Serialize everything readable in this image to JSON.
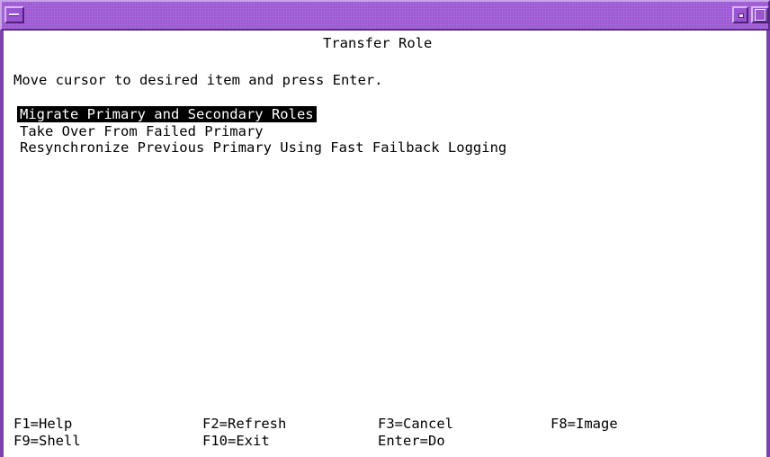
{
  "window": {
    "title": "Transfer Role"
  },
  "screen": {
    "instruction": "Move cursor to desired item and press Enter.",
    "options": [
      {
        "label": "Migrate Primary and Secondary Roles",
        "selected": true
      },
      {
        "label": "Take Over From Failed Primary",
        "selected": false
      },
      {
        "label": "Resynchronize Previous Primary Using Fast Failback Logging",
        "selected": false
      }
    ]
  },
  "function_keys": {
    "row1": [
      "F1=Help",
      "F2=Refresh",
      "F3=Cancel",
      "F8=Image"
    ],
    "row2": [
      "F9=Shell",
      "F10=Exit",
      "Enter=Do"
    ]
  },
  "colors": {
    "titlebar": "#9a55d3",
    "background": "#ffffff",
    "text": "#000000",
    "highlight_bg": "#000000",
    "highlight_fg": "#ffffff"
  },
  "icons": {
    "window_menu": "window-menu-icon",
    "minimize": "minimize-icon",
    "maximize": "maximize-icon"
  }
}
